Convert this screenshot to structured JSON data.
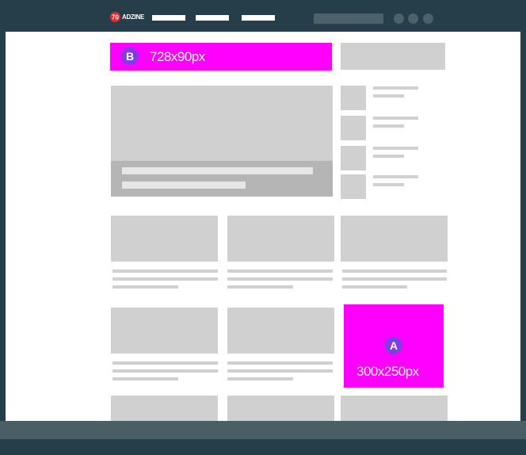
{
  "header": {
    "brand": "ADZINE",
    "nav_links": [
      "",
      "",
      ""
    ],
    "icon_buttons": [
      "circle-icon",
      "circle-icon",
      "circle-icon"
    ]
  },
  "ads": [
    {
      "badge": "B",
      "label": "728x90px"
    },
    {
      "badge": "A",
      "label": "300x250px"
    }
  ],
  "colors": {
    "frame": "#263e49",
    "ad_placeholder": "#ff00ff",
    "badge": "#7b3fe4",
    "content_placeholder": "#d0d0d0",
    "footer": "#4a5e66"
  }
}
